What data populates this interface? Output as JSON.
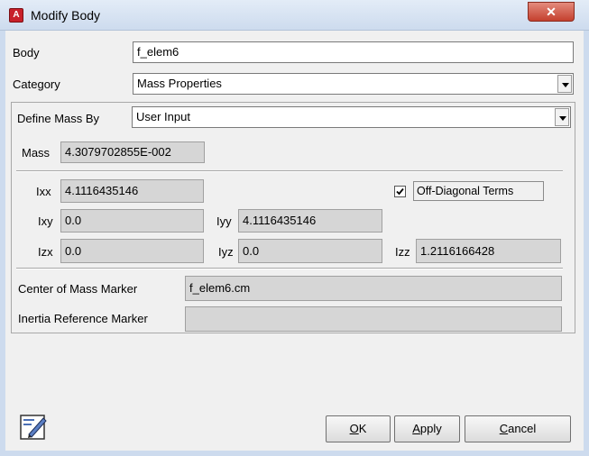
{
  "window": {
    "title": "Modify Body",
    "close_glyph": "✕",
    "app_icon": "adams-app-icon",
    "app_icon_glyph": "A"
  },
  "form": {
    "body_label": "Body",
    "body_value": "f_elem6",
    "category_label": "Category",
    "category_value": "Mass Properties",
    "define_mass_label": "Define Mass By",
    "define_mass_value": "User Input"
  },
  "mass": {
    "label": "Mass",
    "value": "4.3079702855E-002"
  },
  "inertia": {
    "ixx_label": "Ixx",
    "ixx_value": "4.1116435146",
    "off_diagonal_label": "Off-Diagonal Terms",
    "off_diagonal_checked": true,
    "ixy_label": "Ixy",
    "ixy_value": "0.0",
    "iyy_label": "Iyy",
    "iyy_value": "4.1116435146",
    "izx_label": "Izx",
    "izx_value": "0.0",
    "iyz_label": "Iyz",
    "iyz_value": "0.0",
    "izz_label": "Izz",
    "izz_value": "1.2116166428"
  },
  "markers": {
    "cm_label": "Center of Mass Marker",
    "cm_value": "f_elem6.cm",
    "inertia_ref_label": "Inertia Reference Marker",
    "inertia_ref_value": ""
  },
  "buttons": {
    "ok_mnemonic": "O",
    "ok_rest": "K",
    "apply_mnemonic": "A",
    "apply_rest": "pply",
    "cancel_mnemonic": "C",
    "cancel_rest": "ancel"
  },
  "colors": {
    "close_button": "#c4402e",
    "app_icon": "#c8202a",
    "readonly_field": "#d6d6d6"
  }
}
